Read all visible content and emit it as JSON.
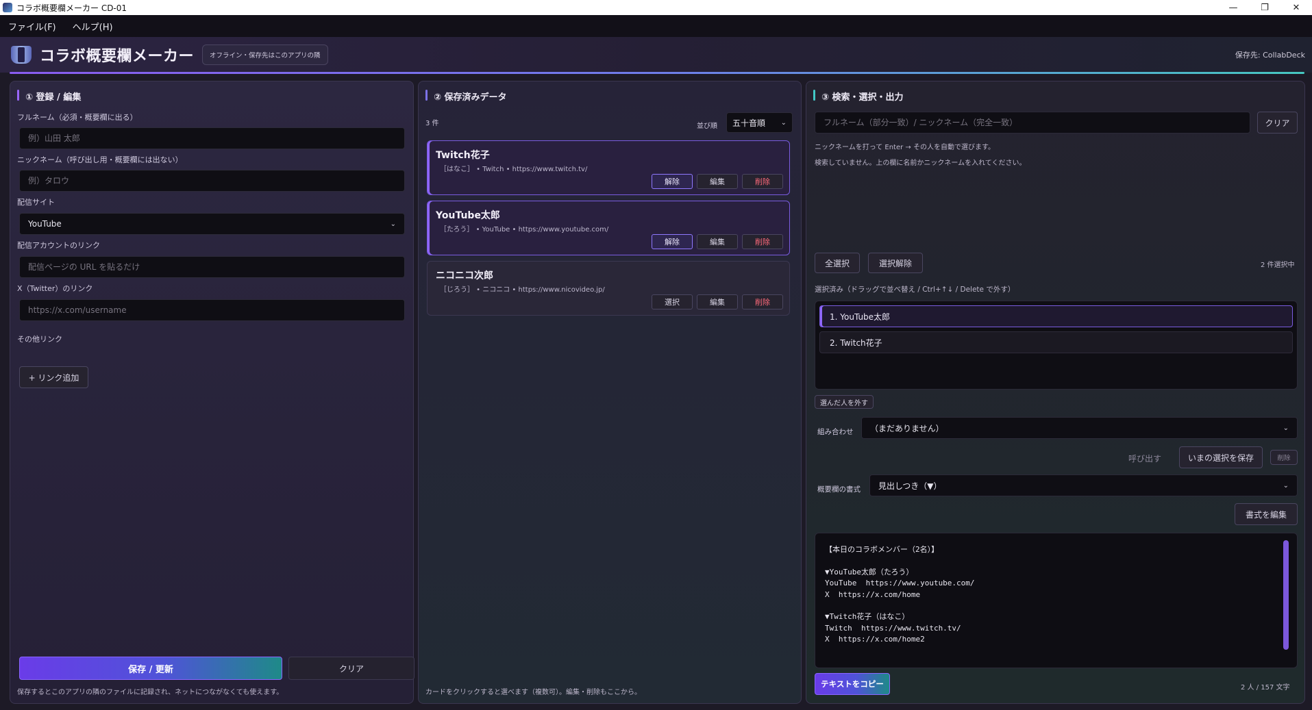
{
  "window": {
    "title": "コラボ概要欄メーカー  CD-01",
    "minimize": "—",
    "maximize": "❐",
    "close": "✕"
  },
  "menu": [
    "ファイル(F)",
    "ヘルプ(H)"
  ],
  "header": {
    "title": "コラボ概要欄メーカー",
    "badge": "オフライン・保存先はこのアプリの隣",
    "save_location": "保存先: CollabDeck"
  },
  "panel1": {
    "title": "① 登録 / 編集",
    "fullname_label": "フルネーム（必須・概要欄に出る）",
    "fullname_placeholder": "例）山田 太郎",
    "nickname_label": "ニックネーム（呼び出し用・概要欄には出ない）",
    "nickname_placeholder": "例）タロウ",
    "site_label": "配信サイト",
    "site_value": "YouTube",
    "account_label": "配信アカウントのリンク",
    "account_placeholder": "配信ページの URL を貼るだけ",
    "x_label": "X（Twitter）のリンク",
    "x_placeholder": "https://x.com/username",
    "other_label": "その他リンク",
    "add_link": "+ リンク追加",
    "save_button": "保存 / 更新",
    "clear_button": "クリア",
    "hint": "保存するとこのアプリの隣のファイルに記録され、ネットにつながなくても使えます。"
  },
  "panel2": {
    "title": "② 保存済みデータ",
    "count": "3 件",
    "sort_label": "並び順",
    "sort_value": "五十音順",
    "cards": [
      {
        "name": "Twitch花子",
        "meta": "［はなこ］ • Twitch • https://www.twitch.tv/",
        "toggle": "解除",
        "edit": "編集",
        "delete": "削除",
        "selected": true
      },
      {
        "name": "YouTube太郎",
        "meta": "［たろう］ • YouTube • https://www.youtube.com/",
        "toggle": "解除",
        "edit": "編集",
        "delete": "削除",
        "selected": true
      },
      {
        "name": "ニコニコ次郎",
        "meta": "［じろう］ • ニコニコ • https://www.nicovideo.jp/",
        "toggle": "選択",
        "edit": "編集",
        "delete": "削除",
        "selected": false
      }
    ],
    "hint": "カードをクリックすると選べます（複数可）。編集・削除もここから。"
  },
  "panel3": {
    "title": "③ 検索・選択・出力",
    "search_placeholder": "フルネーム（部分一致）/ ニックネーム（完全一致）",
    "search_clear": "クリア",
    "help1": "ニックネームを打って Enter → その人を自動で選びます。",
    "help2": "検索していません。上の欄に名前かニックネームを入れてください。",
    "select_all": "全選択",
    "deselect": "選択解除",
    "selected_count": "2 件選択中",
    "selected_label": "選択済み（ドラッグで並べ替え / Ctrl+↑↓ / Delete で外す）",
    "selected_items": [
      "1.  YouTube太郎",
      "2.  Twitch花子"
    ],
    "remove_selected": "選んだ人を外す",
    "combo_label": "組み合わせ",
    "combo_value": "（まだありません）",
    "load": "呼び出す",
    "save_combo": "いまの選択を保存",
    "delete_combo": "削除",
    "format_label": "概要欄の書式",
    "format_value": "見出しつき（▼）",
    "edit_format": "書式を編集",
    "output_lines": [
      "【本日のコラボメンバー（2名）】",
      "",
      "▼YouTube太郎（たろう）",
      "YouTube  https://www.youtube.com/",
      "X  https://x.com/home",
      "",
      "▼Twitch花子（はなこ）",
      "Twitch  https://www.twitch.tv/",
      "X  https://x.com/home2"
    ],
    "copy_button": "テキストをコピー",
    "stats": "2 人 / 157 文字"
  }
}
